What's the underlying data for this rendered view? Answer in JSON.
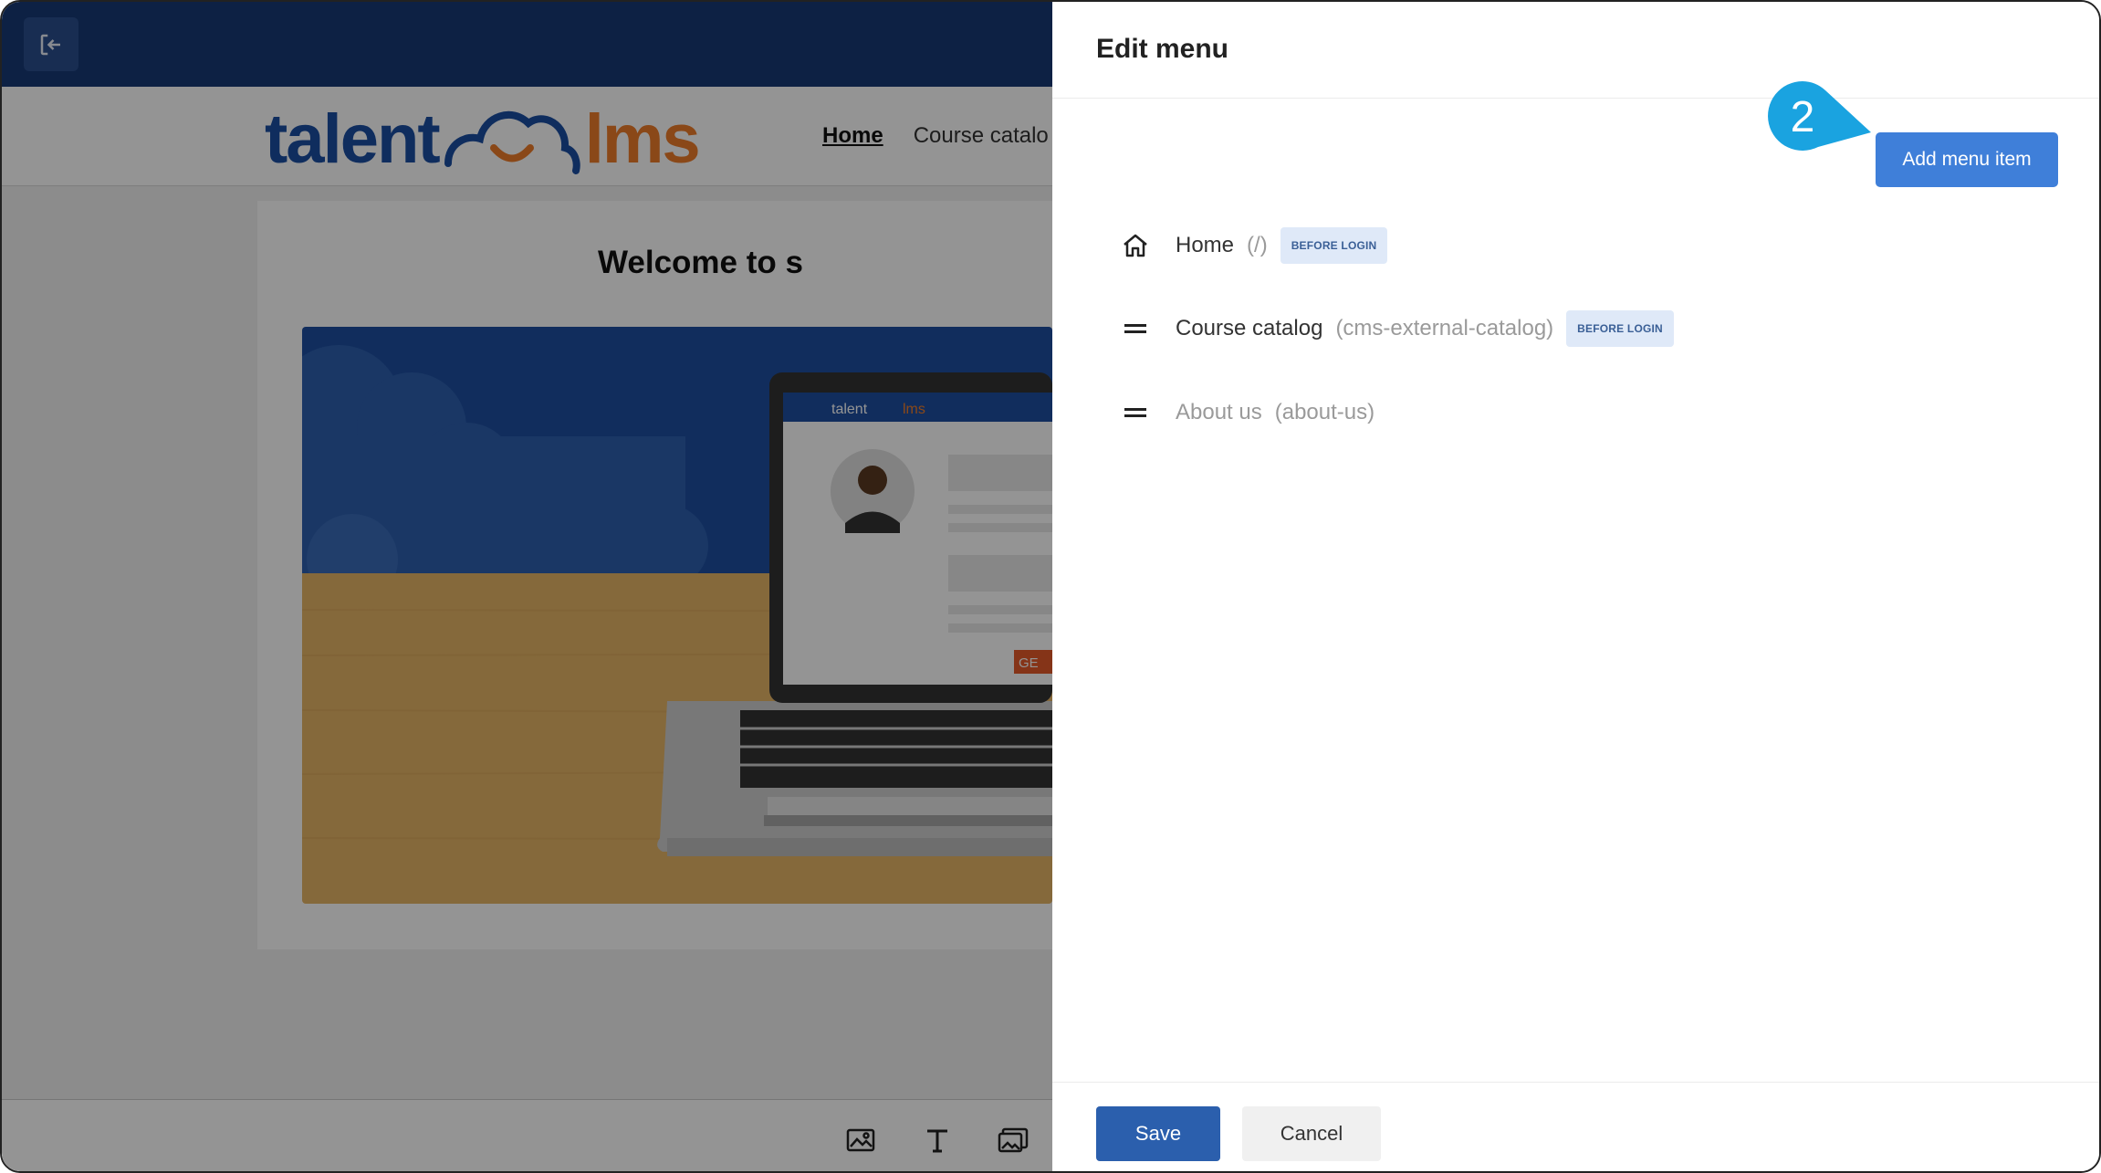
{
  "editor": {
    "logo": {
      "part1": "talent",
      "part2": "lms"
    },
    "nav": {
      "home": "Home",
      "course_catalog": "Course catalo"
    },
    "welcome": "Welcome to s",
    "hero": {
      "laptop_logo_part1": "talent",
      "laptop_logo_part2": "lms",
      "cta": "GE"
    }
  },
  "panel": {
    "title": "Edit menu",
    "add_button": "Add menu item",
    "callout_number": "2",
    "menu_items": [
      {
        "label": "Home",
        "slug": "(/)",
        "badge": "BEFORE LOGIN"
      },
      {
        "label": "Course catalog",
        "slug": "(cms-external-catalog)",
        "badge": "BEFORE LOGIN"
      },
      {
        "label": "About us",
        "slug": "(about-us)"
      }
    ],
    "save_button": "Save",
    "cancel_button": "Cancel"
  },
  "colors": {
    "primary": "#3f7fd9",
    "save": "#2b5fad",
    "callout": "#1aa3e0",
    "badge_bg": "#dfe9f8"
  }
}
